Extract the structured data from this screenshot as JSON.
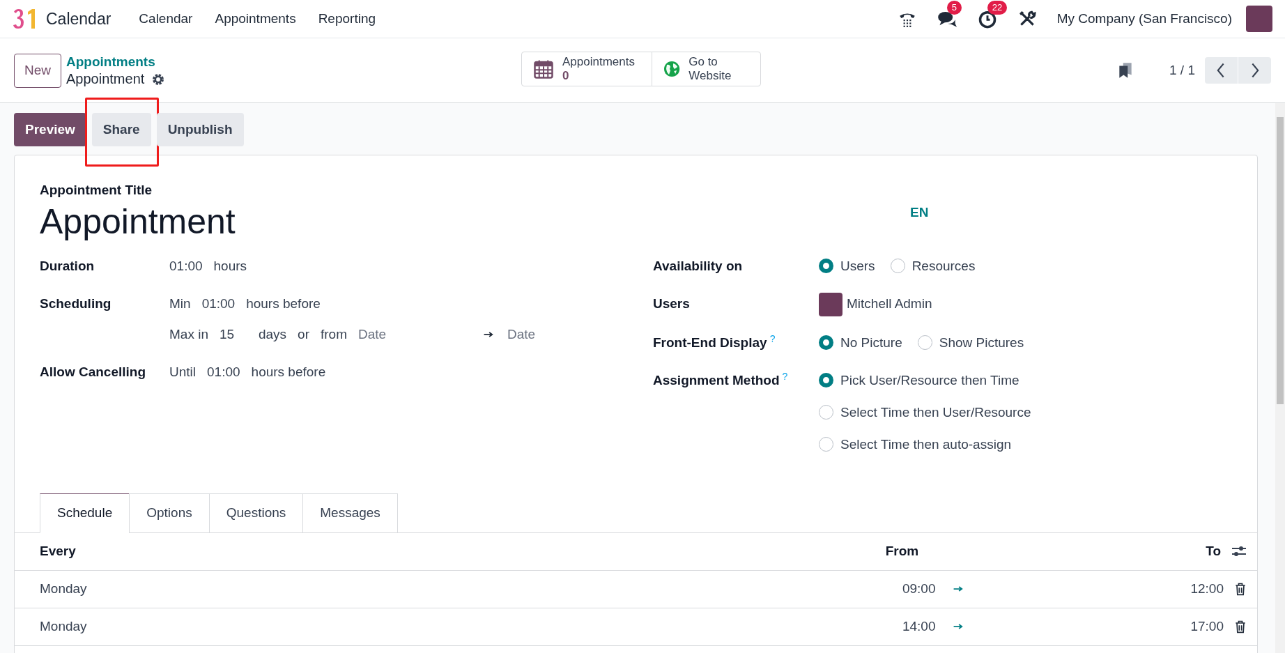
{
  "navbar": {
    "app_name": "Calendar",
    "menu": [
      "Calendar",
      "Appointments",
      "Reporting"
    ],
    "messages_badge": "5",
    "activities_badge": "22",
    "company": "My Company (San Francisco)"
  },
  "control_panel": {
    "new_button": "New",
    "breadcrumb": "Appointments",
    "record_name": "Appointment",
    "smart_buttons": [
      {
        "kind": "calendar",
        "label": "Appointments",
        "value": "0"
      },
      {
        "kind": "globe",
        "label": "Go to Website"
      }
    ],
    "pager": "1 / 1"
  },
  "action_buttons": [
    {
      "label": "Preview",
      "primary": true,
      "highlighted": false
    },
    {
      "label": "Share",
      "primary": false,
      "highlighted": true
    },
    {
      "label": "Unpublish",
      "primary": false,
      "highlighted": false
    }
  ],
  "form": {
    "title_label": "Appointment Title",
    "title": "Appointment",
    "language": "EN",
    "left_fields": [
      {
        "label": "Duration",
        "lines": [
          [
            {
              "kind": "input",
              "text": "01:00"
            },
            {
              "kind": "text",
              "text": "hours"
            }
          ]
        ]
      },
      {
        "label": "Scheduling",
        "lines": [
          [
            {
              "kind": "text",
              "text": "Min"
            },
            {
              "kind": "input",
              "text": "01:00"
            },
            {
              "kind": "text",
              "text": "hours before"
            }
          ],
          [
            {
              "kind": "text",
              "text": "Max in"
            },
            {
              "kind": "input",
              "text": "15"
            },
            {
              "kind": "text",
              "text": "days"
            },
            {
              "kind": "text",
              "text": "or"
            },
            {
              "kind": "text",
              "text": "from"
            },
            {
              "kind": "placeholder",
              "text": "Date"
            },
            {
              "kind": "arrow"
            },
            {
              "kind": "placeholder",
              "text": "Date"
            }
          ]
        ]
      },
      {
        "label": "Allow Cancelling",
        "lines": [
          [
            {
              "kind": "text",
              "text": "Until"
            },
            {
              "kind": "input",
              "text": "01:00"
            },
            {
              "kind": "text",
              "text": "hours before"
            }
          ]
        ]
      }
    ],
    "right_fields": [
      {
        "kind": "radio",
        "label": "Availability on",
        "options": [
          {
            "label": "Users",
            "selected": true
          },
          {
            "label": "Resources",
            "selected": false
          }
        ]
      },
      {
        "kind": "user",
        "label": "Users",
        "user": "Mitchell Admin"
      },
      {
        "kind": "radio",
        "label": "Front-End Display",
        "help": "?",
        "options": [
          {
            "label": "No Picture",
            "selected": true
          },
          {
            "label": "Show Pictures",
            "selected": false
          }
        ]
      },
      {
        "kind": "radio",
        "label": "Assignment Method",
        "help": "?",
        "options": [
          {
            "label": "Pick User/Resource then Time",
            "selected": true
          },
          {
            "label": "Select Time then User/Resource",
            "selected": false
          },
          {
            "label": "Select Time then auto-assign",
            "selected": false
          }
        ]
      }
    ]
  },
  "tabs": [
    {
      "label": "Schedule",
      "selected": true
    },
    {
      "label": "Options",
      "selected": false
    },
    {
      "label": "Questions",
      "selected": false
    },
    {
      "label": "Messages",
      "selected": false
    }
  ],
  "schedule": {
    "columns": [
      "Every",
      "From",
      "To"
    ],
    "rows": [
      {
        "every": "Monday",
        "from": "09:00",
        "to": "12:00"
      },
      {
        "every": "Monday",
        "from": "14:00",
        "to": "17:00"
      }
    ]
  }
}
